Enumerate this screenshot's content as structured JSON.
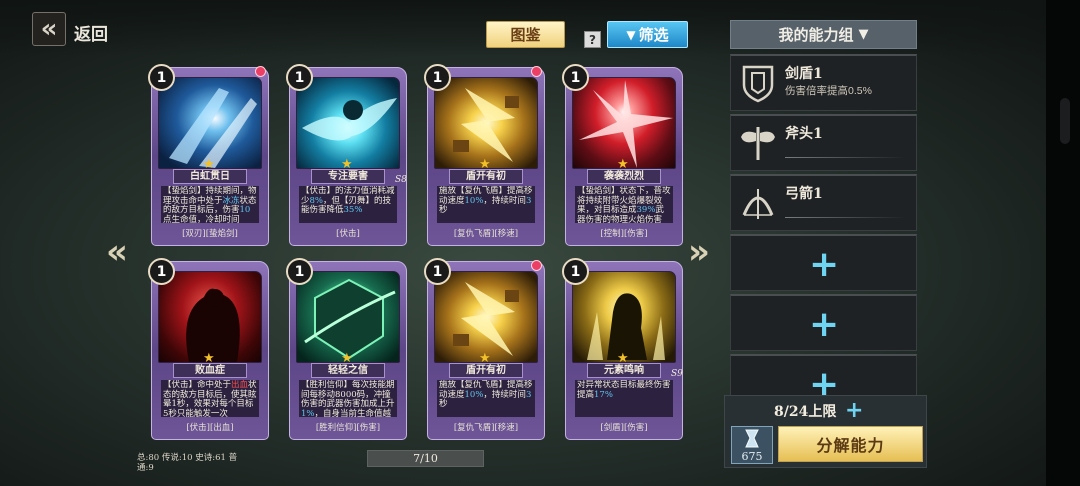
{
  "header": {
    "back_label": "返回",
    "tujian_label": "图鉴",
    "help_icon": "?",
    "filter_label": "筛选",
    "ability_group_label": "我的能力组"
  },
  "cards": [
    {
      "level": "1",
      "name": "白虹贯日",
      "desc_segments": [
        {
          "t": "【蛰焰剑】持续期间，物理攻击命中处于"
        },
        {
          "t": "冰冻",
          "c": "hl"
        },
        {
          "t": "状态的敌方目标后，伤害"
        },
        {
          "t": "10",
          "c": "hl"
        },
        {
          "t": "点生命值，冷却时间"
        }
      ],
      "tags": "[双刃][蛰焰剑]",
      "dot": true,
      "badge": "",
      "art": "art-blue"
    },
    {
      "level": "1",
      "name": "专注要害",
      "desc_segments": [
        {
          "t": "【伏击】的法力值消耗减少"
        },
        {
          "t": "8%",
          "c": "hl"
        },
        {
          "t": "，但【刃舞】的技能伤害降低"
        },
        {
          "t": "35%",
          "c": "hl"
        }
      ],
      "tags": "[伏击]",
      "dot": false,
      "badge": "S8",
      "art": "art-cyan"
    },
    {
      "level": "1",
      "name": "盾开有初",
      "desc_segments": [
        {
          "t": "施放【复仇飞盾】提高移动速度"
        },
        {
          "t": "10%",
          "c": "hl"
        },
        {
          "t": "，持续时间"
        },
        {
          "t": "3",
          "c": "hl"
        },
        {
          "t": "秒"
        }
      ],
      "tags": "[复仇飞盾][移速]",
      "dot": true,
      "badge": "",
      "art": "art-gold"
    },
    {
      "level": "1",
      "name": "袭袭烈烈",
      "desc_segments": [
        {
          "t": "【蛰焰剑】状态下，普攻将持续附带火焰爆裂效果，对目标造成"
        },
        {
          "t": "39%",
          "c": "hl"
        },
        {
          "t": "武器伤害的物理火焰伤害"
        }
      ],
      "tags": "[控制][伤害]",
      "dot": false,
      "badge": "",
      "art": "art-red"
    },
    {
      "level": "1",
      "name": "败血症",
      "desc_segments": [
        {
          "t": "【伏击】命中处于"
        },
        {
          "t": "出血",
          "c": "hlr"
        },
        {
          "t": "状态的敌方目标后，使其眩晕1秒，效果对每个目标5秒只能触发一次"
        }
      ],
      "tags": "[伏击][出血]",
      "dot": false,
      "badge": "",
      "art": "art-blood"
    },
    {
      "level": "1",
      "name": "轻轻之信",
      "desc_segments": [
        {
          "t": "【胜利信仰】每次技能期间每移动8000码，冲撞伤害的武器伤害加成上升"
        },
        {
          "t": "1%",
          "c": "hl"
        },
        {
          "t": "，自身当前生命值越低"
        }
      ],
      "tags": "[胜利信仰][伤害]",
      "dot": false,
      "badge": "",
      "art": "art-green"
    },
    {
      "level": "1",
      "name": "盾开有初",
      "desc_segments": [
        {
          "t": "施放【复仇飞盾】提高移动速度"
        },
        {
          "t": "10%",
          "c": "hl"
        },
        {
          "t": "，持续时间"
        },
        {
          "t": "3",
          "c": "hl"
        },
        {
          "t": "秒"
        }
      ],
      "tags": "[复仇飞盾][移速]",
      "dot": true,
      "badge": "",
      "art": "art-gold"
    },
    {
      "level": "1",
      "name": "元素鸣响",
      "desc_segments": [
        {
          "t": "对异常状态目标最终伤害提高"
        },
        {
          "t": "17%",
          "c": "hl"
        }
      ],
      "tags": "[剑盾][伤害]",
      "dot": false,
      "badge": "S9",
      "art": "art-yellow"
    }
  ],
  "stats_text": "总:80 传说:10 史诗:61 普通:9",
  "pager_text": "7/10",
  "nav": {
    "prev": "«",
    "next": "»"
  },
  "ability_slots": [
    {
      "name": "剑盾1",
      "desc": "伤害倍率提高0.5%",
      "icon": "shield-emblem-icon",
      "filled": true
    },
    {
      "name": "斧头1",
      "desc": "",
      "icon": "axe-icon",
      "filled": true
    },
    {
      "name": "弓箭1",
      "desc": "",
      "icon": "bow-icon",
      "filled": true
    },
    {
      "filled": false,
      "icon": "plus-icon",
      "plus": "+"
    },
    {
      "filled": false,
      "icon": "plus-icon",
      "plus": "+"
    },
    {
      "filled": false,
      "icon": "plus-icon",
      "plus": "+"
    }
  ],
  "limit_text": "8/24上限",
  "limit_plus": "+",
  "currency_value": "675",
  "decompose_label": "分解能力"
}
